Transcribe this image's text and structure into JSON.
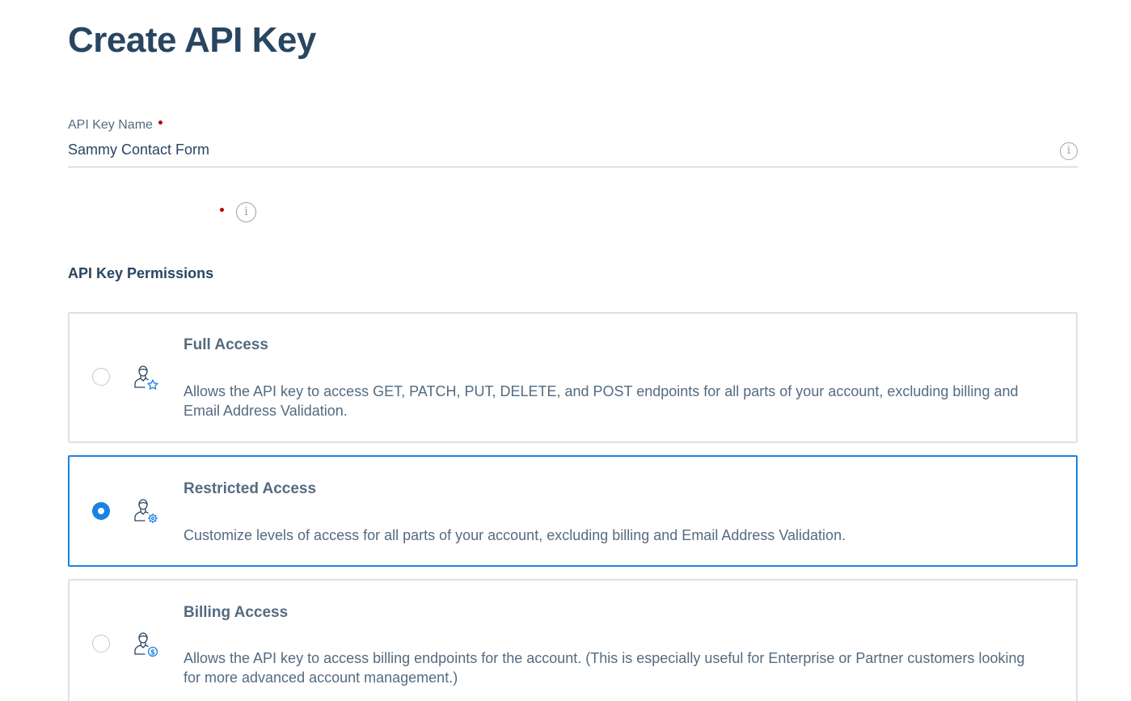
{
  "page": {
    "title": "Create API Key"
  },
  "api_key_name": {
    "label": "API Key Name",
    "value": "Sammy Contact Form",
    "required": true,
    "info_icon": "info-icon"
  },
  "permissions": {
    "heading": "API Key Permissions",
    "options": [
      {
        "title": "Full Access",
        "description": "Allows the API key to access GET, PATCH, PUT, DELETE, and POST endpoints for all parts of your account, excluding billing and Email Address Validation.",
        "selected": false,
        "icon": "user-star-icon"
      },
      {
        "title": "Restricted Access",
        "description": "Customize levels of access for all parts of your account, excluding billing and Email Address Validation.",
        "selected": true,
        "icon": "user-gear-icon"
      },
      {
        "title": "Billing Access",
        "description": "Allows the API key to access billing endpoints for the account. (This is especially useful for Enterprise or Partner customers looking for more advanced account management.)",
        "selected": false,
        "icon": "user-dollar-icon"
      }
    ]
  },
  "colors": {
    "heading": "#294661",
    "body_text": "#546b81",
    "accent": "#1a82e2",
    "required": "#b80000",
    "border": "#dde1e4"
  }
}
